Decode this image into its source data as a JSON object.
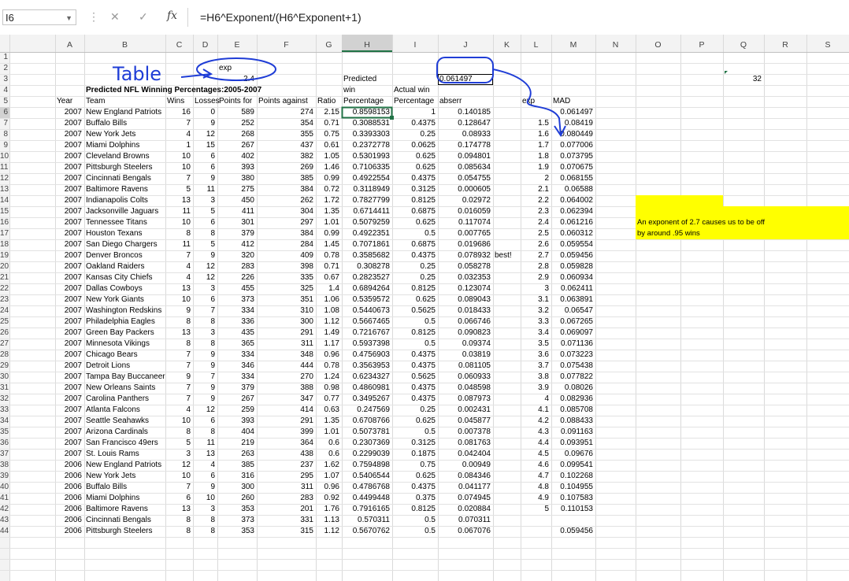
{
  "formula_bar": {
    "name_box": "I6",
    "cancel_icon": "✕",
    "enter_icon": "✓",
    "fx_label": "fx",
    "formula": "=H6^Exponent/(H6^Exponent+1)"
  },
  "columns": [
    "A",
    "B",
    "C",
    "D",
    "E",
    "F",
    "G",
    "H",
    "I",
    "J",
    "K",
    "L",
    "M",
    "N",
    "O",
    "P",
    "Q",
    "R",
    "S",
    "T"
  ],
  "row_numbers": [
    "1",
    "2",
    "3",
    "4",
    "5",
    "6",
    "7",
    "8",
    "9",
    "10",
    "11",
    "12",
    "13",
    "14",
    "15",
    "16",
    "17",
    "18",
    "19",
    "20",
    "21",
    "22",
    "23",
    "24",
    "25",
    "26",
    "27",
    "28",
    "29",
    "30",
    "31",
    "32",
    "33",
    "34",
    "35",
    "36",
    "37",
    "38",
    "39",
    "40",
    "41",
    "42",
    "43",
    "44"
  ],
  "top": {
    "exp_label": "exp",
    "exp_value": "2.4",
    "k3_value": "0.061497",
    "handwritten_table": "Table",
    "title": "Predicted NFL Winning Percentages:2005-2007",
    "r3_value": "32"
  },
  "headers": {
    "year": "Year",
    "team": "Team",
    "wins": "Wins",
    "losses": "Losses",
    "points_for": "Points for",
    "points_against": "Points against",
    "ratio": "Ratio",
    "pred_1": "Predicted",
    "pred_2": "win",
    "pred_3": "Percentage",
    "actual_1": "Actual win",
    "actual_2": "Percentage",
    "abserr": "abserr",
    "exp": "exp",
    "mad": "MAD"
  },
  "note": {
    "line1": "An exponent of 2.7 causes us to be off",
    "line2": "by around .95 wins",
    "fill": "#ffff00"
  },
  "best_label": "best!",
  "rows": [
    [
      "2007",
      "New England Patriots",
      "16",
      "0",
      "589",
      "274",
      "2.15",
      "0.8598153",
      "1",
      "0.140185",
      "",
      "0.061497"
    ],
    [
      "2007",
      "Buffalo Bills",
      "7",
      "9",
      "252",
      "354",
      "0.71",
      "0.3088531",
      "0.4375",
      "0.128647",
      "1.5",
      "0.08419"
    ],
    [
      "2007",
      "New York Jets",
      "4",
      "12",
      "268",
      "355",
      "0.75",
      "0.3393303",
      "0.25",
      "0.08933",
      "1.6",
      "0.080449"
    ],
    [
      "2007",
      "Miami Dolphins",
      "1",
      "15",
      "267",
      "437",
      "0.61",
      "0.2372778",
      "0.0625",
      "0.174778",
      "1.7",
      "0.077006"
    ],
    [
      "2007",
      "Cleveland Browns",
      "10",
      "6",
      "402",
      "382",
      "1.05",
      "0.5301993",
      "0.625",
      "0.094801",
      "1.8",
      "0.073795"
    ],
    [
      "2007",
      "Pittsburgh Steelers",
      "10",
      "6",
      "393",
      "269",
      "1.46",
      "0.7106335",
      "0.625",
      "0.085634",
      "1.9",
      "0.070675"
    ],
    [
      "2007",
      "Cincinnati Bengals",
      "7",
      "9",
      "380",
      "385",
      "0.99",
      "0.4922554",
      "0.4375",
      "0.054755",
      "2",
      "0.068155"
    ],
    [
      "2007",
      "Baltimore Ravens",
      "5",
      "11",
      "275",
      "384",
      "0.72",
      "0.3118949",
      "0.3125",
      "0.000605",
      "2.1",
      "0.06588"
    ],
    [
      "2007",
      "Indianapolis Colts",
      "13",
      "3",
      "450",
      "262",
      "1.72",
      "0.7827799",
      "0.8125",
      "0.02972",
      "2.2",
      "0.064002"
    ],
    [
      "2007",
      "Jacksonville Jaguars",
      "11",
      "5",
      "411",
      "304",
      "1.35",
      "0.6714411",
      "0.6875",
      "0.016059",
      "2.3",
      "0.062394"
    ],
    [
      "2007",
      "Tennessee Titans",
      "10",
      "6",
      "301",
      "297",
      "1.01",
      "0.5079259",
      "0.625",
      "0.117074",
      "2.4",
      "0.061216"
    ],
    [
      "2007",
      "Houston Texans",
      "8",
      "8",
      "379",
      "384",
      "0.99",
      "0.4922351",
      "0.5",
      "0.007765",
      "2.5",
      "0.060312"
    ],
    [
      "2007",
      "San Diego Chargers",
      "11",
      "5",
      "412",
      "284",
      "1.45",
      "0.7071861",
      "0.6875",
      "0.019686",
      "2.6",
      "0.059554"
    ],
    [
      "2007",
      "Denver Broncos",
      "7",
      "9",
      "320",
      "409",
      "0.78",
      "0.3585682",
      "0.4375",
      "0.078932",
      "2.7",
      "0.059456"
    ],
    [
      "2007",
      "Oakland Raiders",
      "4",
      "12",
      "283",
      "398",
      "0.71",
      "0.308278",
      "0.25",
      "0.058278",
      "2.8",
      "0.059828"
    ],
    [
      "2007",
      "Kansas City Chiefs",
      "4",
      "12",
      "226",
      "335",
      "0.67",
      "0.2823527",
      "0.25",
      "0.032353",
      "2.9",
      "0.060934"
    ],
    [
      "2007",
      "Dallas Cowboys",
      "13",
      "3",
      "455",
      "325",
      "1.4",
      "0.6894264",
      "0.8125",
      "0.123074",
      "3",
      "0.062411"
    ],
    [
      "2007",
      "New York Giants",
      "10",
      "6",
      "373",
      "351",
      "1.06",
      "0.5359572",
      "0.625",
      "0.089043",
      "3.1",
      "0.063891"
    ],
    [
      "2007",
      "Washington Redskins",
      "9",
      "7",
      "334",
      "310",
      "1.08",
      "0.5440673",
      "0.5625",
      "0.018433",
      "3.2",
      "0.06547"
    ],
    [
      "2007",
      "Philadelphia Eagles",
      "8",
      "8",
      "336",
      "300",
      "1.12",
      "0.5667465",
      "0.5",
      "0.066746",
      "3.3",
      "0.067265"
    ],
    [
      "2007",
      "Green Bay Packers",
      "13",
      "3",
      "435",
      "291",
      "1.49",
      "0.7216767",
      "0.8125",
      "0.090823",
      "3.4",
      "0.069097"
    ],
    [
      "2007",
      "Minnesota Vikings",
      "8",
      "8",
      "365",
      "311",
      "1.17",
      "0.5937398",
      "0.5",
      "0.09374",
      "3.5",
      "0.071136"
    ],
    [
      "2007",
      "Chicago Bears",
      "7",
      "9",
      "334",
      "348",
      "0.96",
      "0.4756903",
      "0.4375",
      "0.03819",
      "3.6",
      "0.073223"
    ],
    [
      "2007",
      "Detroit Lions",
      "7",
      "9",
      "346",
      "444",
      "0.78",
      "0.3563953",
      "0.4375",
      "0.081105",
      "3.7",
      "0.075438"
    ],
    [
      "2007",
      "Tampa Bay Buccaneer",
      "9",
      "7",
      "334",
      "270",
      "1.24",
      "0.6234327",
      "0.5625",
      "0.060933",
      "3.8",
      "0.077822"
    ],
    [
      "2007",
      "New Orleans Saints",
      "7",
      "9",
      "379",
      "388",
      "0.98",
      "0.4860981",
      "0.4375",
      "0.048598",
      "3.9",
      "0.08026"
    ],
    [
      "2007",
      "Carolina Panthers",
      "7",
      "9",
      "267",
      "347",
      "0.77",
      "0.3495267",
      "0.4375",
      "0.087973",
      "4",
      "0.082936"
    ],
    [
      "2007",
      "Atlanta Falcons",
      "4",
      "12",
      "259",
      "414",
      "0.63",
      "0.247569",
      "0.25",
      "0.002431",
      "4.1",
      "0.085708"
    ],
    [
      "2007",
      "Seattle Seahawks",
      "10",
      "6",
      "393",
      "291",
      "1.35",
      "0.6708766",
      "0.625",
      "0.045877",
      "4.2",
      "0.088433"
    ],
    [
      "2007",
      "Arizona Cardinals",
      "8",
      "8",
      "404",
      "399",
      "1.01",
      "0.5073781",
      "0.5",
      "0.007378",
      "4.3",
      "0.091163"
    ],
    [
      "2007",
      "San Francisco 49ers",
      "5",
      "11",
      "219",
      "364",
      "0.6",
      "0.2307369",
      "0.3125",
      "0.081763",
      "4.4",
      "0.093951"
    ],
    [
      "2007",
      "St. Louis Rams",
      "3",
      "13",
      "263",
      "438",
      "0.6",
      "0.2299039",
      "0.1875",
      "0.042404",
      "4.5",
      "0.09676"
    ],
    [
      "2006",
      "New England Patriots",
      "12",
      "4",
      "385",
      "237",
      "1.62",
      "0.7594898",
      "0.75",
      "0.00949",
      "4.6",
      "0.099541"
    ],
    [
      "2006",
      "New York Jets",
      "10",
      "6",
      "316",
      "295",
      "1.07",
      "0.5406544",
      "0.625",
      "0.084346",
      "4.7",
      "0.102268"
    ],
    [
      "2006",
      "Buffalo Bills",
      "7",
      "9",
      "300",
      "311",
      "0.96",
      "0.4786768",
      "0.4375",
      "0.041177",
      "4.8",
      "0.104955"
    ],
    [
      "2006",
      "Miami Dolphins",
      "6",
      "10",
      "260",
      "283",
      "0.92",
      "0.4499448",
      "0.375",
      "0.074945",
      "4.9",
      "0.107583"
    ],
    [
      "2006",
      "Baltimore Ravens",
      "13",
      "3",
      "353",
      "201",
      "1.76",
      "0.7916165",
      "0.8125",
      "0.020884",
      "5",
      "0.110153"
    ],
    [
      "2006",
      "Cincinnati Bengals",
      "8",
      "8",
      "373",
      "331",
      "1.13",
      "0.570311",
      "0.5",
      "0.070311",
      "",
      ""
    ],
    [
      "2006",
      "Pittsburgh Steelers",
      "8",
      "8",
      "353",
      "315",
      "1.12",
      "0.5670762",
      "0.5",
      "0.067076",
      "",
      "0.059456"
    ]
  ]
}
